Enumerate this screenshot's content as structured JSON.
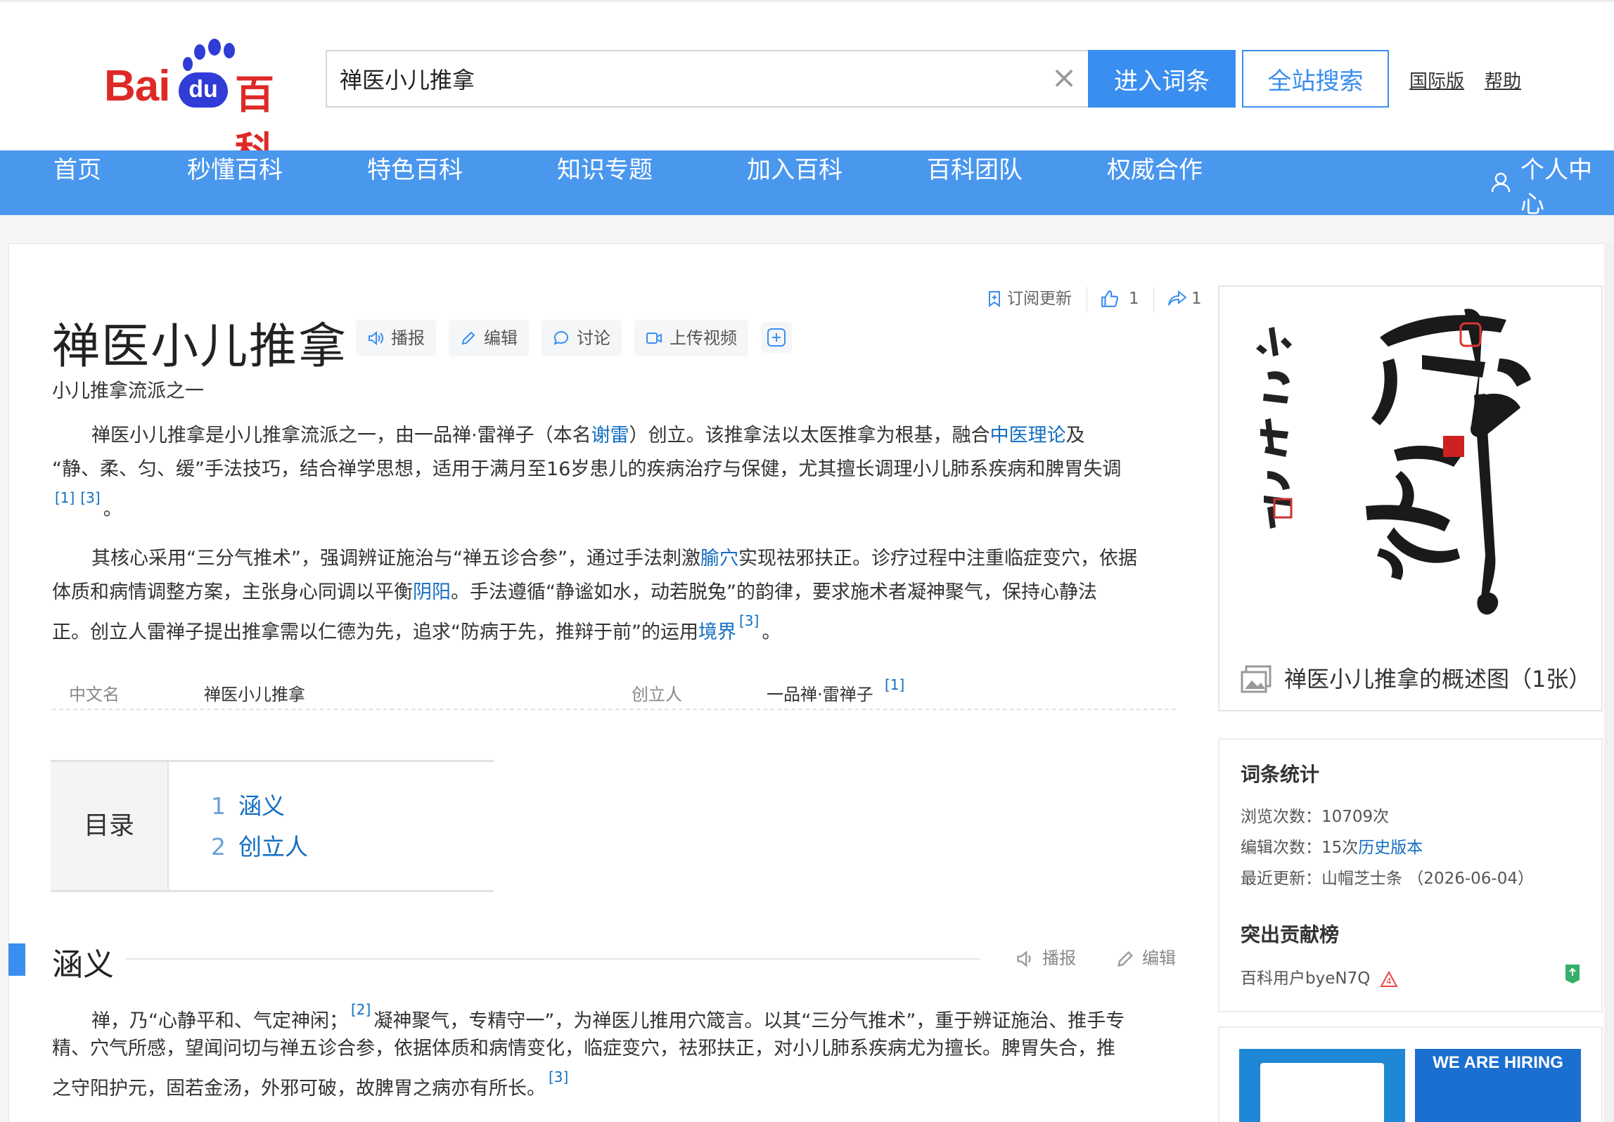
{
  "header": {
    "logo_text_bai": "Bai",
    "logo_text_du": "du",
    "logo_text_baike": "百科",
    "search_value": "禅医小儿推拿",
    "enter_button": "进入词条",
    "site_search_button": "全站搜索",
    "international_link": "国际版",
    "help_link": "帮助"
  },
  "nav": {
    "items": [
      "首页",
      "秒懂百科",
      "特色百科",
      "知识专题",
      "加入百科",
      "百科团队",
      "权威合作"
    ],
    "user_center": "个人中心"
  },
  "article": {
    "title": "禅医小儿推拿",
    "subtitle": "小儿推拿流派之一",
    "tools": {
      "broadcast": "播报",
      "edit": "编辑",
      "discuss": "讨论",
      "upload_video": "上传视频"
    },
    "top_actions": {
      "subscribe": "订阅更新",
      "like_count": "1",
      "share_count": "1"
    },
    "p1": {
      "a": "禅医小儿推拿是小儿推拿流派之一，由一品禅·雷禅子（本名",
      "link1": "谢雷",
      "b": "）创立。该推拿法以太医推拿为根基，融合",
      "link2": "中医理论",
      "c": "及",
      "line2": "“静、柔、匀、缓”手法技巧，结合禅学思想，适用于满月至16岁患儿的疾病治疗与保健，尤其擅长调理小儿肺系疾病和脾胃失调",
      "ref1": "[1]",
      "ref2": "[3]",
      "end": "。"
    },
    "p2": {
      "a": "其核心采用“三分气推术”，强调辨证施治与“禅五诊合参”，通过手法刺激",
      "link1": "腧穴",
      "b": "实现祛邪扶正。诊疗过程中注重临症变穴，依据",
      "c": "体质和病情调整方案，主张身心同调以平衡",
      "link2": "阴阳",
      "d": "。手法遵循“静谧如水，动若脱兔”的韵律，要求施术者凝神聚气，保持心静法",
      "e": "正。创立人雷禅子提出推拿需以仁德为先，追求“防病于先，推辩于前”的运用",
      "link3": "境界",
      "ref": "[3]",
      "end": "。"
    },
    "info": {
      "k1": "中文名",
      "v1": "禅医小儿推拿",
      "k2": "创立人",
      "v2": "一品禅·雷禅子",
      "ref": "[1]"
    },
    "toc": {
      "label": "目录",
      "items": [
        {
          "num": "1",
          "text": "涵义"
        },
        {
          "num": "2",
          "text": "创立人"
        }
      ]
    },
    "section1": {
      "title": "涵义",
      "broadcast": "播报",
      "edit": "编辑",
      "line1a": "禅，乃“心静平和、气定神闲；",
      "ref1": "[2]",
      "line1b": "凝神聚气，专精守一”，为禅医儿推用穴箴言。以其“三分气推术”，重于辨证施治、推手专",
      "line2": "精、穴气所感，望闻问切与禅五诊合参，依据体质和病情变化，临症变穴，祛邪扶正，对小儿肺系疾病尤为擅长。脾胃失合，推",
      "line3": "之守阳护元，固若金汤，外邪可破，故脾胃之病亦有所长。",
      "ref2": "[3]"
    }
  },
  "sidebar": {
    "album_caption": "禅医小儿推拿的概述图（1张）",
    "stats_title": "词条统计",
    "views": "浏览次数：10709次",
    "edits_a": "编辑次数：15次",
    "edits_link": "历史版本",
    "updated": "最近更新：山帽芝士条 （2026-06-04）",
    "contrib_title": "突出贡献榜",
    "contrib_user": "百科用户byeN7Q",
    "ad_text": "WE ARE HIRING"
  },
  "colors": {
    "brand_blue": "#4a97ee",
    "button_blue": "#3a8ef0",
    "link": "#136ec2",
    "logo_red": "#de2a27"
  }
}
